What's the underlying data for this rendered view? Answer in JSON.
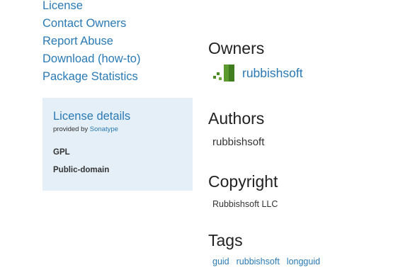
{
  "sidebar": {
    "links": [
      {
        "label": "License"
      },
      {
        "label": "Contact Owners"
      },
      {
        "label": "Report Abuse"
      },
      {
        "label": "Download (how-to)"
      },
      {
        "label": "Package Statistics"
      }
    ],
    "license_box": {
      "title": "License details",
      "provided_by_prefix": "provided by ",
      "provider": "Sonatype",
      "licenses": [
        "GPL",
        "Public-domain"
      ]
    }
  },
  "main": {
    "owners": {
      "heading": "Owners",
      "items": [
        {
          "name": "rubbishsoft",
          "avatar_icon": "green-pixel-logo-icon"
        }
      ]
    },
    "authors": {
      "heading": "Authors",
      "value": "rubbishsoft"
    },
    "copyright": {
      "heading": "Copyright",
      "value": "Rubbishsoft LLC"
    },
    "tags": {
      "heading": "Tags",
      "items": [
        "guid",
        "rubbishsoft",
        "longguid"
      ]
    }
  },
  "colors": {
    "link": "#2a7ab6",
    "license_box_bg": "#e4eff7",
    "heading": "#222222",
    "text": "#333333",
    "avatar_green": "#3a7a1a"
  }
}
